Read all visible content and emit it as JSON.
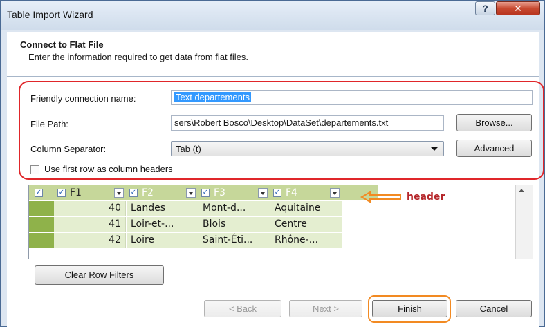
{
  "window": {
    "title": "Table Import Wizard",
    "help_glyph": "?",
    "close_glyph": "✕"
  },
  "header": {
    "title": "Connect to Flat File",
    "subtitle": "Enter the information required to get data from flat files."
  },
  "form": {
    "friendly_label": "Friendly connection name:",
    "friendly_value": "Text departements",
    "filepath_label": "File Path:",
    "filepath_value": "sers\\Robert Bosco\\Desktop\\DataSet\\departements.txt",
    "browse_label": "Browse...",
    "separator_label": "Column Separator:",
    "separator_value": "Tab (t)",
    "advanced_label": "Advanced",
    "first_row_label": "Use first row as column headers"
  },
  "grid": {
    "columns": [
      {
        "name": "F1",
        "checked": true
      },
      {
        "name": "F2",
        "checked": true
      },
      {
        "name": "F3",
        "checked": true
      },
      {
        "name": "F4",
        "checked": true
      }
    ],
    "rows": [
      [
        "40",
        "Landes",
        "Mont-d...",
        "Aquitaine"
      ],
      [
        "41",
        "Loir-et-...",
        "Blois",
        "Centre"
      ],
      [
        "42",
        "Loire",
        "Saint-Éti...",
        "Rhône-..."
      ]
    ],
    "annotation": "header"
  },
  "buttons": {
    "clear_filters": "Clear Row Filters",
    "back": "< Back",
    "next": "Next >",
    "finish": "Finish",
    "cancel": "Cancel"
  },
  "colors": {
    "highlight_ring": "#e0262a",
    "finish_ring": "#f28a22",
    "annotation_text": "#b5262a",
    "grid_header": "#c6d79a",
    "grid_rows": "#e4eed0"
  },
  "icons": [
    "help-icon",
    "close-icon",
    "chevron-down-icon",
    "checkbox-icon",
    "arrow-left-icon",
    "scroll-up-icon"
  ]
}
